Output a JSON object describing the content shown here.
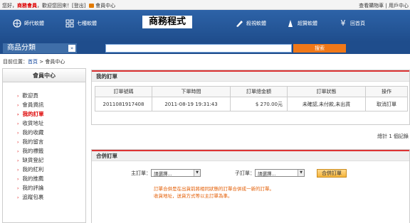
{
  "topbar": {
    "greeting_prefix": "您好，",
    "member_name": "商務會員",
    "greeting_suffix": "，歡迎您回來！",
    "logout": "[登出]",
    "member_center": "會員中心",
    "cart": "查看購物車",
    "divider": "|",
    "user_center": "用戶中心"
  },
  "nav": {
    "items": [
      "師代軟體",
      "七種軟體",
      "商務程式",
      "殺視軟體",
      "超贊軟體",
      "回首頁"
    ],
    "search_tab": "商品"
  },
  "catbar": {
    "title": "商品分類",
    "arrow": "»",
    "search_button": "搜索"
  },
  "breadcrumb": {
    "label": "目前位置：",
    "home": "首頁",
    "sep": " > ",
    "current": "會員中心"
  },
  "sidebar": {
    "title": "會員中心",
    "items": [
      {
        "label": "歡迎頁",
        "active": false
      },
      {
        "label": "會員資訊",
        "active": false
      },
      {
        "label": "我的訂單",
        "active": true
      },
      {
        "label": "收貨地址",
        "active": false
      },
      {
        "label": "我的收藏",
        "active": false
      },
      {
        "label": "我的留言",
        "active": false
      },
      {
        "label": "我的標籤",
        "active": false
      },
      {
        "label": "缺貨登記",
        "active": false
      },
      {
        "label": "我的紅利",
        "active": false
      },
      {
        "label": "我的推薦",
        "active": false
      },
      {
        "label": "我的評論",
        "active": false
      },
      {
        "label": "追蹤包裹",
        "active": false
      }
    ]
  },
  "orders": {
    "title": "我的訂單",
    "columns": [
      "訂單號碼",
      "下單時間",
      "訂單總金額",
      "訂單狀態",
      "操作"
    ],
    "rows": [
      {
        "id": "2011081917408",
        "time": "2011-08-19 19:31:43",
        "amount": "$ 270.00元",
        "status": "未確認,未付款,未出貨",
        "action": "取消訂單"
      }
    ],
    "total_text": "總計 1 個記錄"
  },
  "merge": {
    "title": "合併訂單",
    "main_label": "主訂單：",
    "main_select": "請選擇...",
    "sub_label": "子訂單：",
    "sub_select": "請選擇...",
    "button": "合併訂單",
    "note_line1": "訂單合併是在出貨前將相同狀態的訂單合併成一新的訂單。",
    "note_line2": "收貨地址，送貨方式等以主訂單為準。"
  },
  "colors": {
    "nav_blue": "#1f4d8c",
    "accent_orange": "#f07818",
    "alert_red": "#dd0000"
  }
}
